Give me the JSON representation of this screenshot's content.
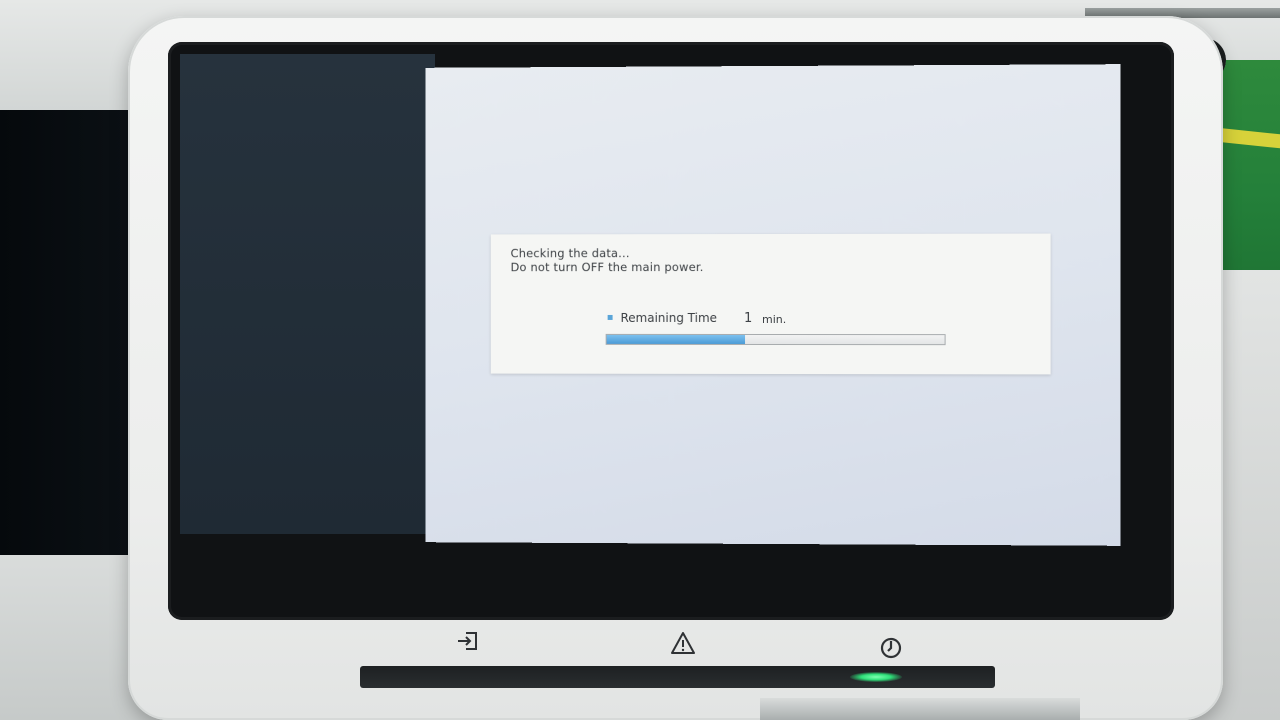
{
  "dialog": {
    "message_line1": "Checking the data...",
    "message_line2": "Do not turn OFF the main power.",
    "remaining_label": "Remaining Time",
    "remaining_value": "1",
    "remaining_unit": "min.",
    "progress_percent": 41
  },
  "hardware_keys": {
    "login_icon": "login-icon",
    "warning_icon": "warning-icon",
    "power_icon": "power-icon"
  },
  "colors": {
    "progress_fill": "#4b9bd6",
    "status_led": "#2fe07a"
  }
}
